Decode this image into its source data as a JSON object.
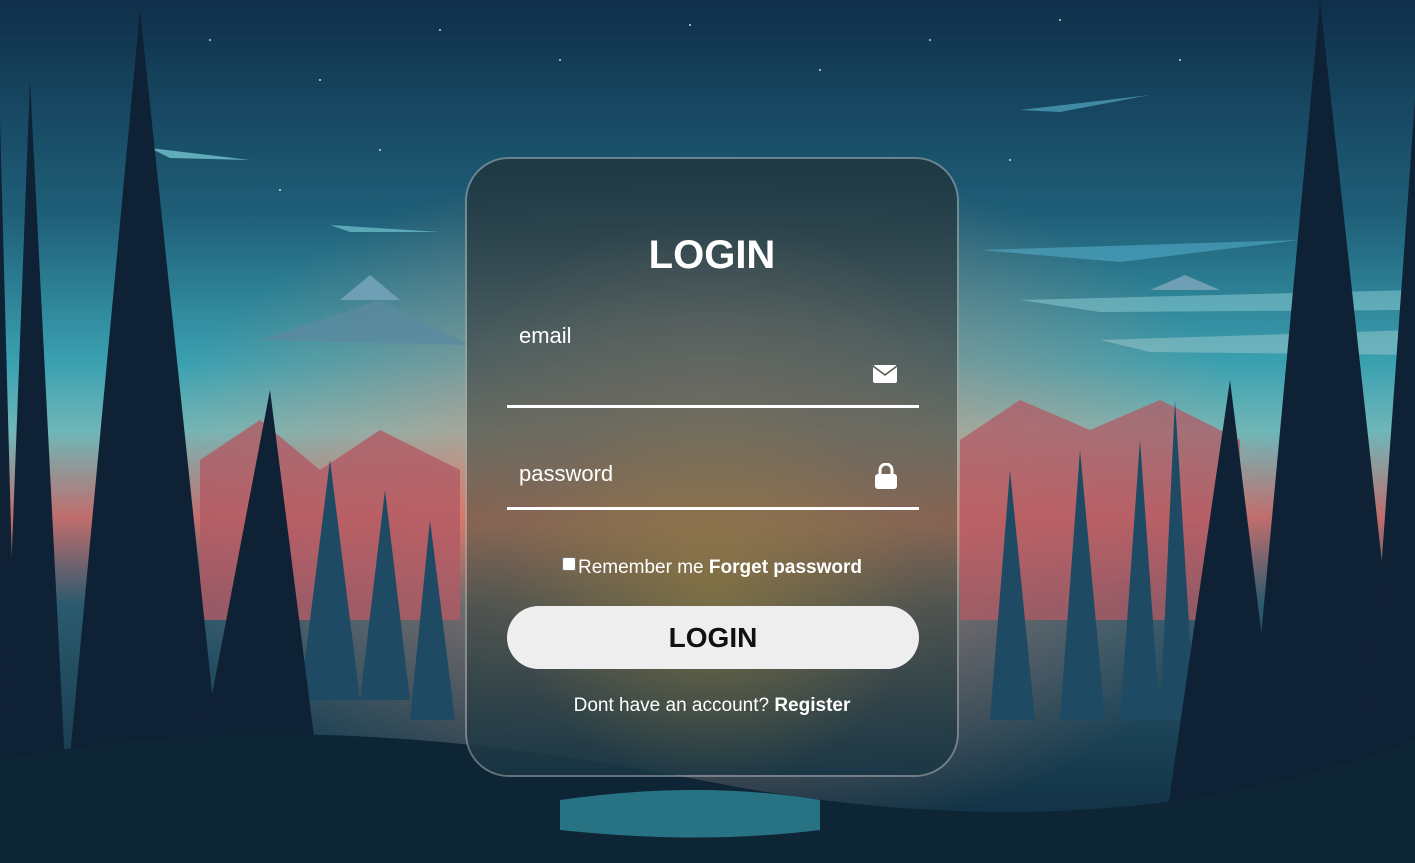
{
  "login": {
    "title": "LOGIN",
    "email_label": "email",
    "password_label": "password",
    "email_icon": "envelope-icon",
    "password_icon": "lock-icon",
    "remember_label": "Remember me",
    "forget_link": "Forget password",
    "login_button": "LOGIN",
    "register_prompt": "Dont have an account?",
    "register_link": "Register"
  },
  "colors": {
    "text": "#ffffff",
    "button_bg": "#eeeeee",
    "button_text": "#111111"
  }
}
